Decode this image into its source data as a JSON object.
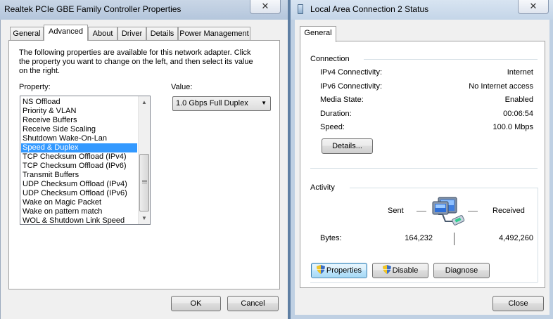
{
  "left_window": {
    "title": "Realtek PCIe GBE Family Controller Properties",
    "close_label": "✕",
    "tabs": [
      "General",
      "Advanced",
      "About",
      "Driver",
      "Details",
      "Power Management"
    ],
    "description": [
      "The following properties are available for this network adapter. Click",
      "the property you want to change on the left, and then select its value",
      "on the right."
    ],
    "property_label": "Property:",
    "value_label": "Value:",
    "properties": [
      "NS Offload",
      "Priority & VLAN",
      "Receive Buffers",
      "Receive Side Scaling",
      "Shutdown Wake-On-Lan",
      "Speed & Duplex",
      "TCP Checksum Offload (IPv4)",
      "TCP Checksum Offload (IPv6)",
      "Transmit Buffers",
      "UDP Checksum Offload (IPv4)",
      "UDP Checksum Offload (IPv6)",
      "Wake on Magic Packet",
      "Wake on pattern match",
      "WOL & Shutdown Link Speed"
    ],
    "selected_property": "Speed & Duplex",
    "value_selected": "1.0 Gbps Full Duplex",
    "ok_label": "OK",
    "cancel_label": "Cancel"
  },
  "right_window": {
    "title": "Local Area Connection 2 Status",
    "close_label": "✕",
    "tab": "General",
    "connection_heading": "Connection",
    "connection": [
      {
        "label": "IPv4 Connectivity:",
        "value": "Internet"
      },
      {
        "label": "IPv6 Connectivity:",
        "value": "No Internet access"
      },
      {
        "label": "Media State:",
        "value": "Enabled"
      },
      {
        "label": "Duration:",
        "value": "00:06:54"
      },
      {
        "label": "Speed:",
        "value": "100.0 Mbps"
      }
    ],
    "details_label": "Details...",
    "activity_heading": "Activity",
    "sent_label": "Sent",
    "received_label": "Received",
    "bytes_label": "Bytes:",
    "bytes_sent": "164,232",
    "bytes_received": "4,492,260",
    "properties_label": "Properties",
    "disable_label": "Disable",
    "diagnose_label": "Diagnose",
    "close_label_btn": "Close"
  }
}
